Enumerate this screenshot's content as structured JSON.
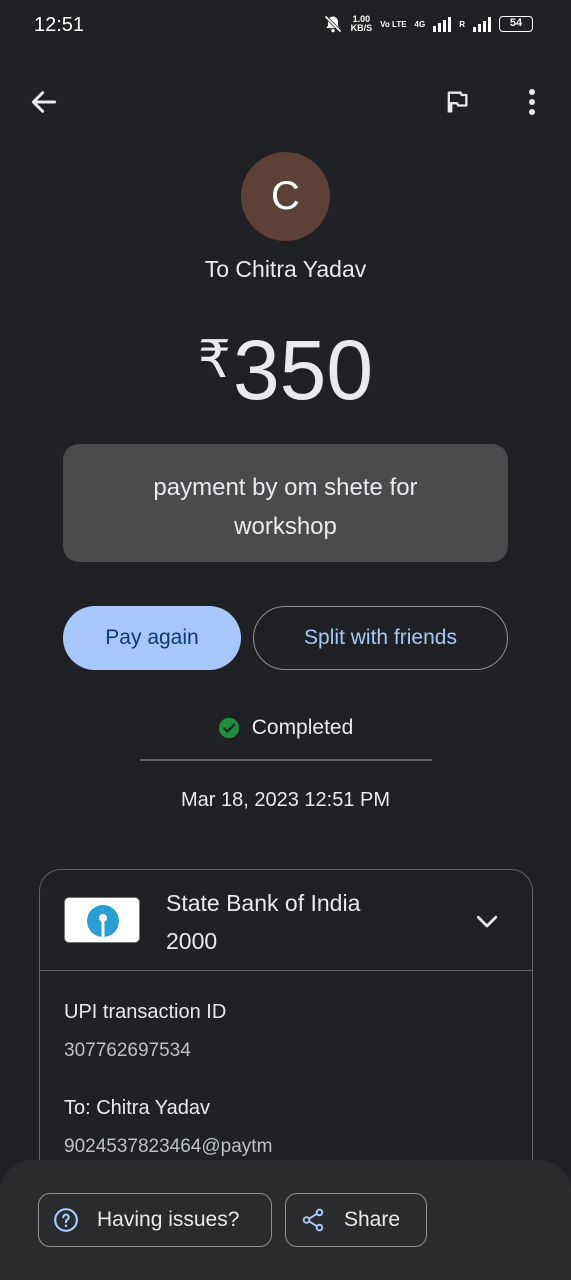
{
  "status_bar": {
    "time": "12:51",
    "net_speed_value": "1.00",
    "net_speed_unit": "KB/S",
    "volte": "Vo LTE",
    "network": "4G",
    "roaming": "R",
    "battery": "54"
  },
  "header": {
    "back_icon": "arrow-back-icon",
    "flag_icon": "flag-icon",
    "more_icon": "more-vert-icon"
  },
  "transaction": {
    "avatar_letter": "C",
    "avatar_color": "#5d4037",
    "recipient_title": "To Chitra Yadav",
    "currency": "₹",
    "amount": "350",
    "note": "payment by om shete for workshop",
    "status": "Completed",
    "status_color": "#1e8e3e",
    "datetime": "Mar 18, 2023 12:51 PM"
  },
  "actions": {
    "pay_again": "Pay again",
    "split": "Split with friends"
  },
  "card": {
    "bank_name": "State Bank of India",
    "bank_suffix": "2000",
    "upi_label": "UPI transaction ID",
    "upi_value": "307762697534",
    "to_label": "To: Chitra Yadav",
    "to_value": "9024537823464@paytm"
  },
  "bottom": {
    "issues": "Having issues?",
    "share": "Share"
  },
  "colors": {
    "background": "#202124",
    "accent": "#a8c7fa"
  }
}
